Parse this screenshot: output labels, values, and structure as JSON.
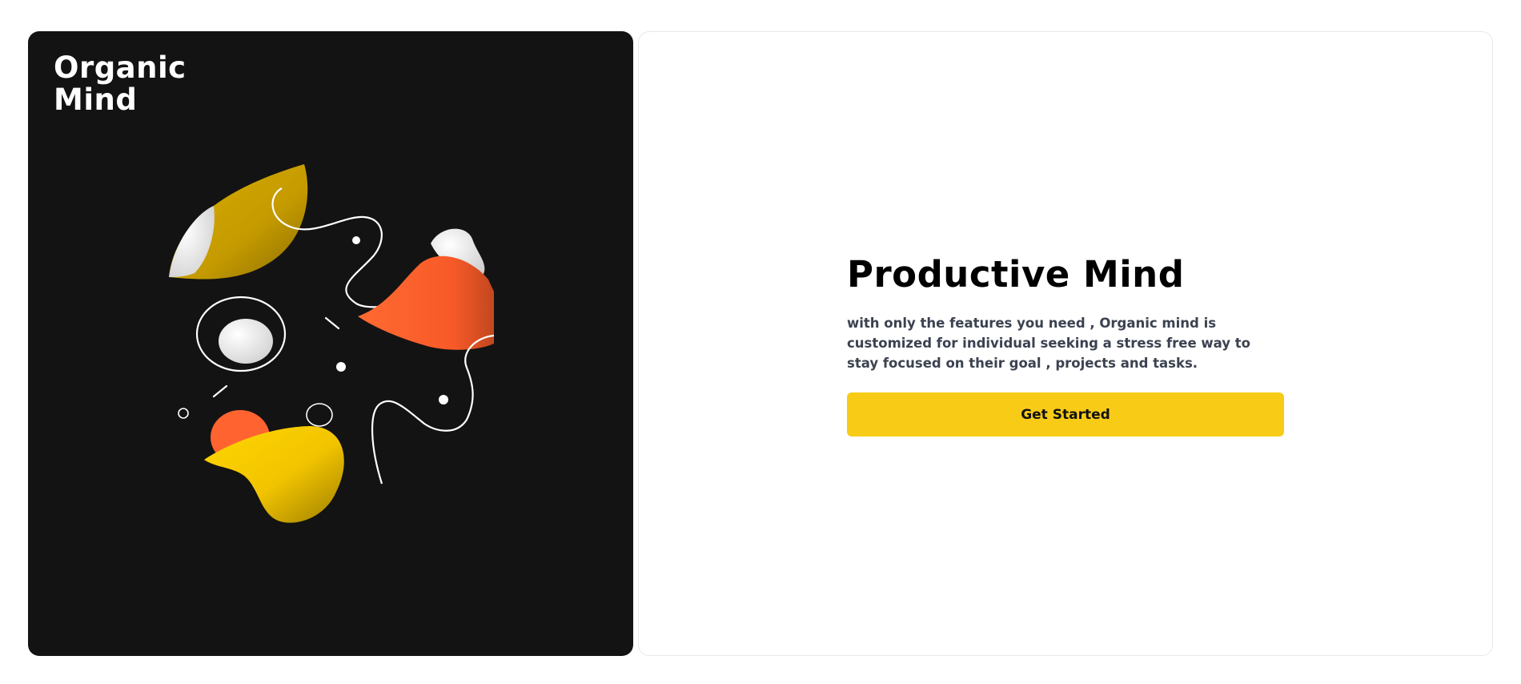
{
  "brand": {
    "line1": "Organic",
    "line2": "Mind"
  },
  "main": {
    "title": "Productive Mind",
    "description": "with only the features you need , Organic mind is customized for individual seeking a stress free way to stay focused on their goal , projects and tasks.",
    "cta_label": "Get Started"
  },
  "colors": {
    "hero_background": "#131313",
    "accent_yellow": "#f8cb17",
    "accent_orange": "#ff6430",
    "text_primary": "#000000",
    "text_secondary": "#3b4250"
  }
}
